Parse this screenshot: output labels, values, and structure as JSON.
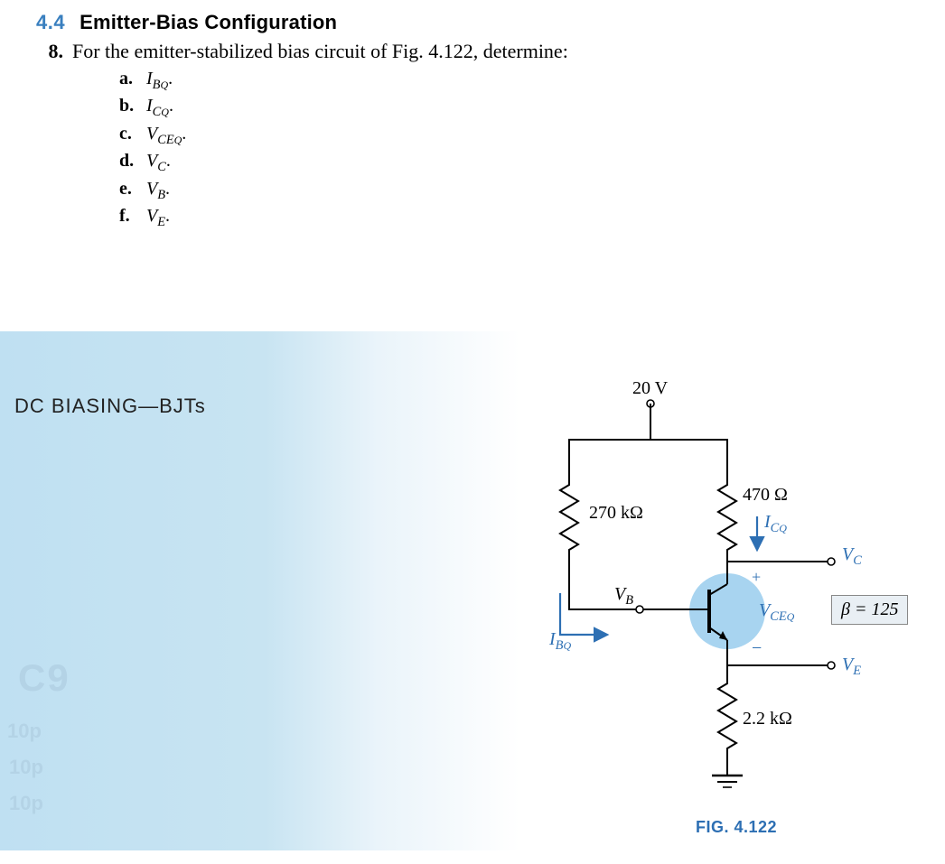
{
  "section": {
    "number": "4.4",
    "title": "Emitter-Bias Configuration"
  },
  "problem": {
    "number": "8.",
    "text": "For the emitter-stabilized bias circuit of Fig. 4.122, determine:",
    "items": [
      {
        "letter": "a.",
        "sym": "I",
        "sub": "B",
        "subsub": "Q",
        "tail": "."
      },
      {
        "letter": "b.",
        "sym": "I",
        "sub": "C",
        "subsub": "Q",
        "tail": "."
      },
      {
        "letter": "c.",
        "sym": "V",
        "sub": "CE",
        "subsub": "Q",
        "tail": "."
      },
      {
        "letter": "d.",
        "sym": "V",
        "sub": "C",
        "subsub": "",
        "tail": "."
      },
      {
        "letter": "e.",
        "sym": "V",
        "sub": "B",
        "subsub": "",
        "tail": "."
      },
      {
        "letter": "f.",
        "sym": "V",
        "sub": "E",
        "subsub": "",
        "tail": "."
      }
    ]
  },
  "panel": {
    "chapterTitle": "DC BIASING—BJTs",
    "ghost": {
      "c9": "C9",
      "s1": "10p",
      "s2": "10p",
      "s3": "10p"
    }
  },
  "figure": {
    "caption": "FIG. 4.122",
    "vcc": "20 V",
    "rb": "270 kΩ",
    "rc": "470 Ω",
    "re": "2.2 kΩ",
    "ibq_sym": "I",
    "ibq_sub": "B",
    "ibq_subsub": "Q",
    "icq_sym": "I",
    "icq_sub": "C",
    "icq_subsub": "Q",
    "vceq_sym": "V",
    "vceq_sub": "CE",
    "vceq_subsub": "Q",
    "vb_sym": "V",
    "vb_sub": "B",
    "vc_sym": "V",
    "vc_sub": "C",
    "ve_sym": "V",
    "ve_sub": "E",
    "plus": "+",
    "minus": "−",
    "beta": "β = 125"
  }
}
